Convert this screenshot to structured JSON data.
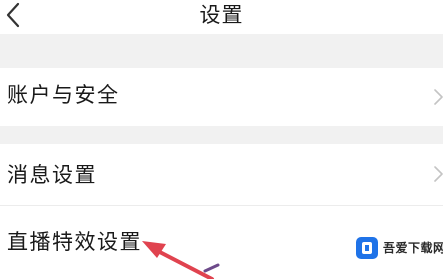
{
  "header": {
    "title": "设置",
    "back_icon": "chevron-left-icon"
  },
  "settings": {
    "items": [
      {
        "label": "账户与安全",
        "chevron_icon": "chevron-right-icon"
      },
      {
        "label": "消息设置",
        "chevron_icon": "chevron-right-icon"
      },
      {
        "label": "直播特效设置"
      }
    ]
  },
  "annotation": {
    "arrow_color": "#e0434f",
    "arrow_icon": "pointer-arrow-icon"
  },
  "watermark": {
    "text": "吾爱下载网",
    "logo_color": "#1f73e8",
    "logo_icon": "site-logo-icon"
  }
}
